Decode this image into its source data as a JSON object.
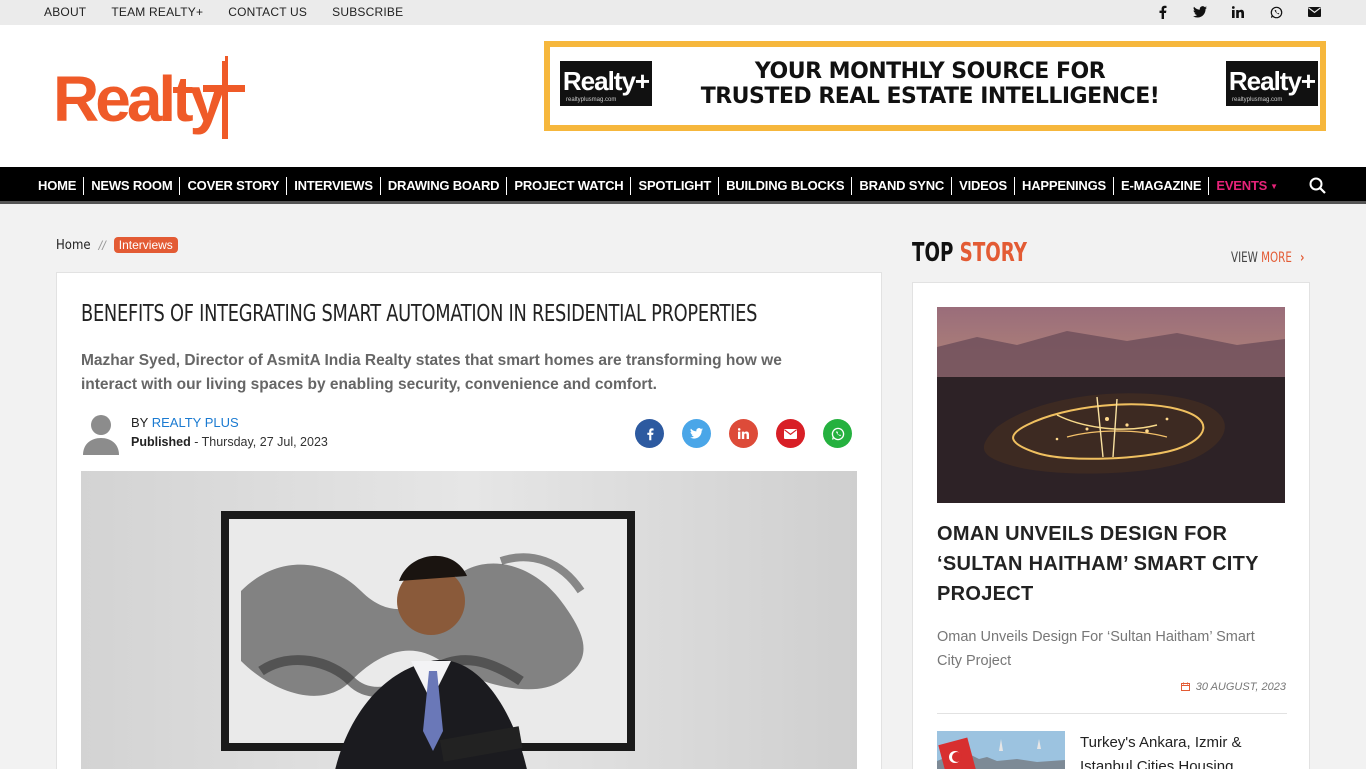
{
  "topnav": [
    "ABOUT",
    "TEAM REALTY+",
    "CONTACT US",
    "SUBSCRIBE"
  ],
  "social_icons": [
    "facebook-icon",
    "twitter-icon",
    "linkedin-icon",
    "whatsapp-icon",
    "email-icon"
  ],
  "brand": {
    "logo_text": "Realty+",
    "accent": "#e35b34"
  },
  "banner": {
    "logo_text": "Realty+",
    "logo_subtext": "realtyplusmag.com",
    "headline_line1": "YOUR MONTHLY SOURCE FOR",
    "headline_line2": "TRUSTED REAL ESTATE INTELLIGENCE!",
    "border_color": "#f6b73c"
  },
  "mainnav": [
    "HOME",
    "NEWS ROOM",
    "COVER STORY",
    "INTERVIEWS",
    "DRAWING BOARD",
    "PROJECT WATCH",
    "SPOTLIGHT",
    "BUILDING BLOCKS",
    "BRAND SYNC",
    "VIDEOS",
    "HAPPENINGS",
    "E-MAGAZINE",
    "EVENTS"
  ],
  "events_color": "#e8237a",
  "breadcrumb": {
    "home": "Home",
    "separator": "//",
    "current": "Interviews"
  },
  "article": {
    "title": "BENEFITS OF INTEGRATING SMART AUTOMATION IN RESIDENTIAL PROPERTIES",
    "summary": "Mazhar Syed, Director of AsmitA India Realty states that smart homes are transforming how we interact with our living spaces by enabling security, convenience and comfort.",
    "by_label": "BY",
    "author": "REALTY PLUS",
    "published_label": "Published",
    "published_date": "- Thursday, 27 Jul, 2023"
  },
  "share": [
    {
      "icon": "facebook-icon",
      "glyph": "f",
      "color": "#2d5aa0"
    },
    {
      "icon": "twitter-icon",
      "glyph": "t",
      "color": "#4aa6e8"
    },
    {
      "icon": "linkedin-icon",
      "glyph": "in",
      "color": "#dd4b39"
    },
    {
      "icon": "email-icon",
      "glyph": "✉",
      "color": "#d81f26"
    },
    {
      "icon": "whatsapp-icon",
      "glyph": "✆",
      "color": "#25b13f"
    }
  ],
  "sidebar": {
    "title_a": "TOP",
    "title_b": "STORY",
    "view": "VIEW",
    "more": "MORE",
    "top_story": {
      "headline": "OMAN UNVEILS DESIGN FOR ‘SULTAN HAITHAM’ SMART CITY PROJECT",
      "subtitle": "Oman Unveils Design For ‘Sultan Haitham’ Smart City Project",
      "date": "30 AUGUST, 2023"
    },
    "second_story": {
      "headline": "Turkey's Ankara, Izmir & Istanbul Cities Housing"
    }
  }
}
